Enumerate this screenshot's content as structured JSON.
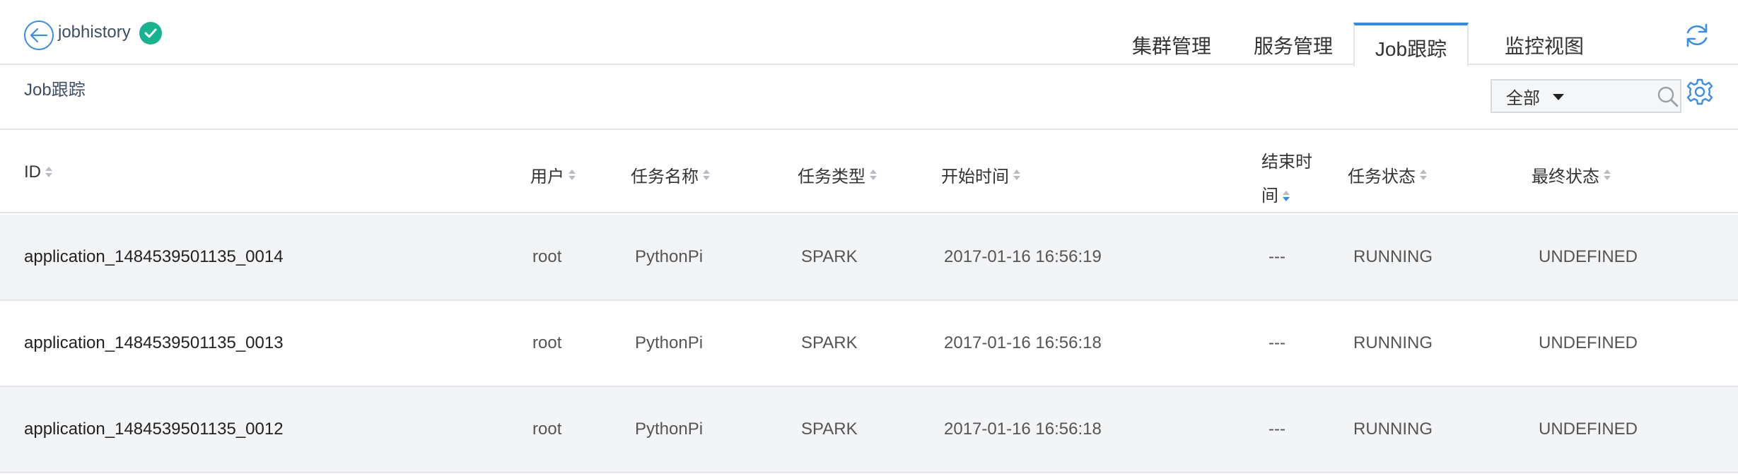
{
  "header": {
    "app_title": "jobhistory",
    "tabs": [
      {
        "label": "集群管理"
      },
      {
        "label": "服务管理"
      },
      {
        "label": "Job跟踪"
      },
      {
        "label": "监控视图"
      }
    ],
    "active_tab": 2
  },
  "subheader": {
    "breadcrumb": "Job跟踪",
    "filter": {
      "selected": "全部"
    },
    "search": {
      "placeholder": ""
    }
  },
  "table": {
    "columns": [
      {
        "label": "ID"
      },
      {
        "label": "用户"
      },
      {
        "label": "任务名称"
      },
      {
        "label": "任务类型"
      },
      {
        "label": "开始时间"
      },
      {
        "label_line1": "结束时",
        "label_line2": "间"
      },
      {
        "label": "任务状态"
      },
      {
        "label": "最终状态"
      }
    ],
    "rows": [
      {
        "id": "application_1484539501135_0014",
        "user": "root",
        "name": "PythonPi",
        "type": "SPARK",
        "start": "2017-01-16 16:56:19",
        "end": "---",
        "status": "RUNNING",
        "final": "UNDEFINED"
      },
      {
        "id": "application_1484539501135_0013",
        "user": "root",
        "name": "PythonPi",
        "type": "SPARK",
        "start": "2017-01-16 16:56:18",
        "end": "---",
        "status": "RUNNING",
        "final": "UNDEFINED"
      },
      {
        "id": "application_1484539501135_0012",
        "user": "root",
        "name": "PythonPi",
        "type": "SPARK",
        "start": "2017-01-16 16:56:18",
        "end": "---",
        "status": "RUNNING",
        "final": "UNDEFINED"
      }
    ]
  },
  "colors": {
    "accent": "#2d8ceb",
    "success": "#17b28e",
    "row_alt": "#f3f4f6"
  },
  "icons": [
    "back-arrow-icon",
    "check-icon",
    "refresh-icon",
    "caret-down-icon",
    "search-icon",
    "gear-icon",
    "sort-icon"
  ]
}
